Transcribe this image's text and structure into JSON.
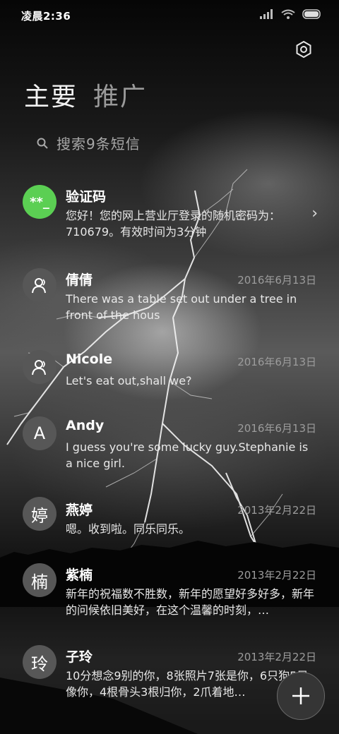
{
  "status": {
    "time": "凌晨2:36"
  },
  "tabs": [
    {
      "label": "主要"
    },
    {
      "label": "推广"
    }
  ],
  "search": {
    "placeholder": "搜索9条短信"
  },
  "messages": [
    {
      "name": "验证码",
      "avatar": "**_",
      "date": "",
      "preview": "您好！您的网上营业厅登录的随机密码为：710679。有效时间为3分钟"
    },
    {
      "name": "倩倩",
      "avatar": "person-icon",
      "date": "2016年6月13日",
      "preview": "There was a table set out under a tree in front of the hous"
    },
    {
      "name": "Nicole",
      "avatar": "person-icon",
      "date": "2016年6月13日",
      "preview": "Let's eat out,shall we?"
    },
    {
      "name": "Andy",
      "avatar": "A",
      "date": "2016年6月13日",
      "preview": "I guess you're some lucky guy.Stephanie is a nice girl."
    },
    {
      "name": "燕婷",
      "avatar": "婷",
      "date": "2013年2月22日",
      "preview": "嗯。收到啦。同乐同乐。"
    },
    {
      "name": "紫楠",
      "avatar": "楠",
      "date": "2013年2月22日",
      "preview": "新年的祝福数不胜数，新年的愿望好多好多，新年的问候依旧美好，在这个温馨的时刻，…"
    },
    {
      "name": "子玲",
      "avatar": "玲",
      "date": "2013年2月22日",
      "preview": "10分想念9别的你，8张照片7张是你，6只狗5只像你，4根骨头3根归你，2爪着地…"
    }
  ],
  "colors": {
    "accent_green": "#5bcf53",
    "avatar_gray": "#575757"
  }
}
